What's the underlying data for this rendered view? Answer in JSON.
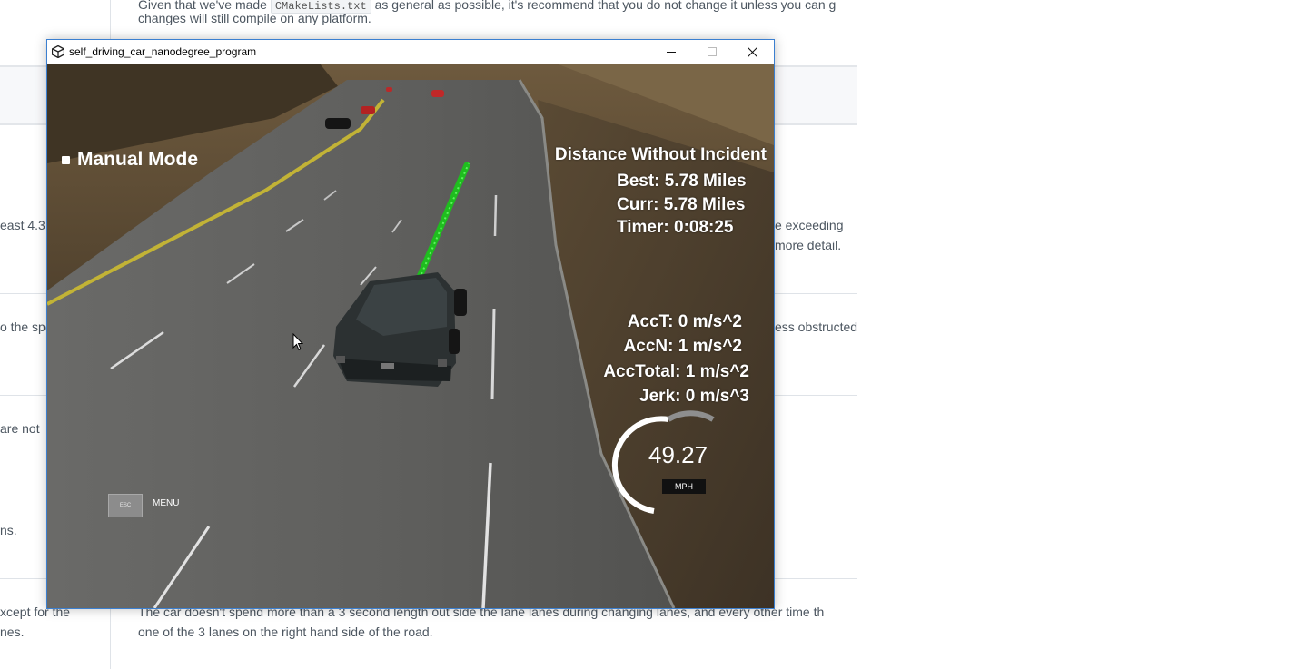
{
  "background_page": {
    "top_text": "Given that we've made",
    "top_code": "CMakeLists.txt",
    "top_text_cont": "as general as possible, it's recommend that you do not change it unless you can g",
    "top_text_line2": "changes will still compile on any platform.",
    "left_fragments": [
      "east 4.3",
      "o the spe",
      "are not",
      "ns.",
      "xcept for the",
      "nes."
    ],
    "right_fragments": [
      "e exceeding",
      "more detail.",
      "ess obstructed"
    ],
    "bottom_line1": "The car doesn't spend more than a 3 second length out side the lane lanes during changing lanes, and every other time th",
    "bottom_line2": "one of the 3 lanes on the right hand side of the road."
  },
  "window": {
    "title": "self_driving_car_nanodegree_program",
    "icon": "unity-icon",
    "controls": [
      "minimize-icon",
      "maximize-icon",
      "close-icon"
    ]
  },
  "hud": {
    "manual_mode": "Manual Mode",
    "distance_heading": "Distance Without Incident",
    "best": "Best: 5.78 Miles",
    "curr": "Curr: 5.78 Miles",
    "timer": "Timer: 0:08:25",
    "acc_t": "AccT: 0 m/s^2",
    "acc_n": "AccN: 1 m/s^2",
    "acc_total": "AccTotal: 1 m/s^2",
    "jerk": "Jerk: 0 m/s^3",
    "speed": "49.27",
    "speed_unit": "MPH",
    "esc_key": "ESC",
    "menu": "MENU"
  },
  "colors": {
    "path": "#22cc22",
    "window_border": "#3b7fd0"
  }
}
